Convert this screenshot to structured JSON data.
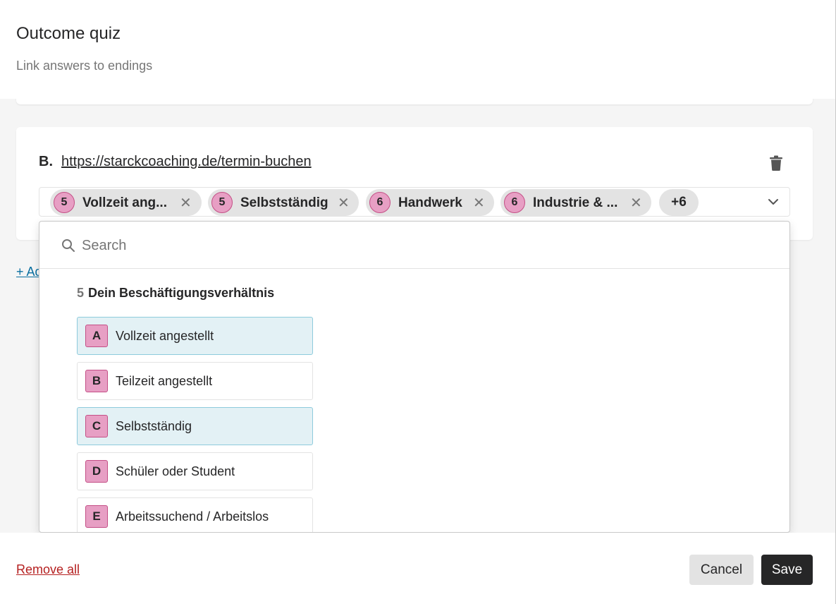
{
  "header": {
    "title": "Outcome quiz",
    "subtitle": "Link answers to endings"
  },
  "ending": {
    "letter": "B.",
    "url": "https://starckcoaching.de/termin-buchen",
    "chips": [
      {
        "question_number": "5",
        "label": "Vollzeit ang..."
      },
      {
        "question_number": "5",
        "label": "Selbstständig"
      },
      {
        "question_number": "6",
        "label": "Handwerk"
      },
      {
        "question_number": "6",
        "label": "Industrie & ..."
      }
    ],
    "more_count": "+6",
    "icons": {
      "delete": "trash-icon",
      "remove_chip": "close-icon",
      "expand": "chevron-down-icon"
    }
  },
  "add_link": "+ Ad",
  "dropdown": {
    "search_placeholder": "Search",
    "question": {
      "number": "5",
      "title": "Dein Beschäftigungsverhältnis"
    },
    "options": [
      {
        "letter": "A",
        "label": "Vollzeit angestellt",
        "selected": true
      },
      {
        "letter": "B",
        "label": "Teilzeit angestellt",
        "selected": false
      },
      {
        "letter": "C",
        "label": "Selbstständig",
        "selected": true
      },
      {
        "letter": "D",
        "label": "Schüler oder Student",
        "selected": false
      },
      {
        "letter": "E",
        "label": "Arbeitssuchend / Arbeitslos",
        "selected": false
      }
    ]
  },
  "footer": {
    "remove_all": "Remove all",
    "cancel": "Cancel",
    "save": "Save"
  },
  "colors": {
    "chip_badge": "#e79fc4",
    "selected_option_bg": "#e3f1f5",
    "save_button": "#262627",
    "remove_all_link": "#b52020",
    "add_link": "#0a6fa0"
  }
}
